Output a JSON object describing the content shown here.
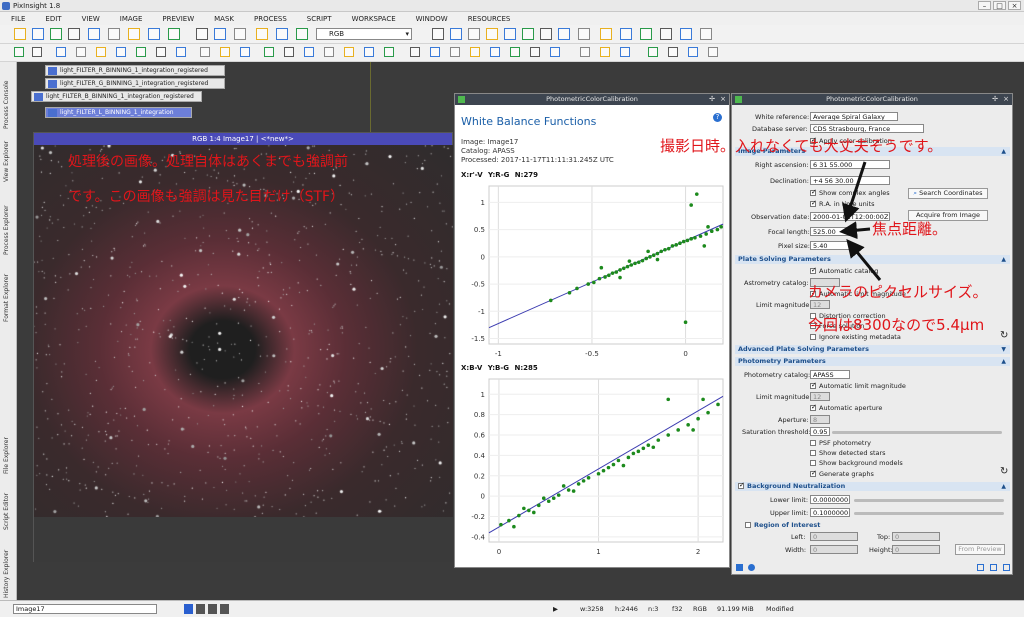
{
  "app_title": "PixInsight 1.8",
  "menu": [
    "FILE",
    "EDIT",
    "VIEW",
    "IMAGE",
    "PREVIEW",
    "MASK",
    "PROCESS",
    "SCRIPT",
    "WORKSPACE",
    "WINDOW",
    "RESOURCES"
  ],
  "toolbar": {
    "rgb_select": "RGB"
  },
  "side_tabs": [
    "Process Console",
    "View Explorer",
    "Process Explorer",
    "Format Explorer",
    "File Explorer",
    "Script Editor",
    "History Explorer"
  ],
  "icon_windows": [
    "light_FILTER_R_BINNING_1_integration_registered",
    "light_FILTER_G_BINNING_1_integration_registered",
    "light_FILTER_B_BINNING_1_integration_registered",
    "light_FILTER_L_BINNING_1_integration"
  ],
  "image_window": {
    "title": "RGB 1:4 Image17 | <*new*>"
  },
  "annotations": {
    "note1_line1": "処理後の画像。処理自体はあくまでも強調前",
    "note1_line2": "です。この画像も強調は見た目だけ（STF）",
    "note2": "撮影日時。入れなくても大丈夫そうです。",
    "note3": "焦点距離。",
    "note4_line1": "カメラのピクセルサイズ。",
    "note4_line2": "今回は8300なので5.4μm"
  },
  "wb_panel": {
    "window_title": "PhotometricColorCalibration",
    "heading": "White Balance Functions",
    "image": "Image: Image17",
    "catalog": "Catalog: APASS",
    "processed": "Processed: 2017-11-17T11:11:31.245Z UTC"
  },
  "chart_data": [
    {
      "type": "scatter",
      "title": "X:r'-V  Y:R-G  N:279",
      "xlim": [
        -1.05,
        0.2
      ],
      "ylim": [
        -1.6,
        1.3
      ],
      "xticks": [
        -1,
        -0.5,
        0
      ],
      "yticks": [
        -1.5,
        -1,
        -0.5,
        0,
        0.5,
        1
      ],
      "fit": {
        "x": [
          -1.05,
          0.2
        ],
        "y": [
          -1.3,
          0.6
        ]
      },
      "points": [
        [
          -0.72,
          -0.8
        ],
        [
          -0.62,
          -0.66
        ],
        [
          -0.58,
          -0.58
        ],
        [
          -0.52,
          -0.5
        ],
        [
          -0.49,
          -0.47
        ],
        [
          -0.46,
          -0.4
        ],
        [
          -0.43,
          -0.37
        ],
        [
          -0.41,
          -0.34
        ],
        [
          -0.39,
          -0.3
        ],
        [
          -0.37,
          -0.28
        ],
        [
          -0.35,
          -0.24
        ],
        [
          -0.33,
          -0.21
        ],
        [
          -0.31,
          -0.18
        ],
        [
          -0.29,
          -0.15
        ],
        [
          -0.27,
          -0.12
        ],
        [
          -0.25,
          -0.1
        ],
        [
          -0.23,
          -0.07
        ],
        [
          -0.21,
          -0.03
        ],
        [
          -0.19,
          0.0
        ],
        [
          -0.17,
          0.03
        ],
        [
          -0.15,
          0.06
        ],
        [
          -0.13,
          0.1
        ],
        [
          -0.11,
          0.13
        ],
        [
          -0.09,
          0.15
        ],
        [
          -0.07,
          0.2
        ],
        [
          -0.05,
          0.22
        ],
        [
          -0.03,
          0.25
        ],
        [
          -0.01,
          0.28
        ],
        [
          0.01,
          0.3
        ],
        [
          0.03,
          0.33
        ],
        [
          0.05,
          0.35
        ],
        [
          0.08,
          0.38
        ],
        [
          0.11,
          0.42
        ],
        [
          0.14,
          0.47
        ],
        [
          0.17,
          0.5
        ],
        [
          0.19,
          0.55
        ],
        [
          -0.3,
          -0.08
        ],
        [
          -0.45,
          -0.2
        ],
        [
          0.03,
          0.95
        ],
        [
          0.06,
          1.15
        ],
        [
          0.0,
          -1.2
        ],
        [
          -0.2,
          0.1
        ],
        [
          0.1,
          0.2
        ],
        [
          -0.35,
          -0.38
        ],
        [
          -0.15,
          -0.05
        ],
        [
          0.12,
          0.55
        ]
      ]
    },
    {
      "type": "scatter",
      "title": "X:B-V  Y:B-G  N:285",
      "xlim": [
        -0.1,
        2.25
      ],
      "ylim": [
        -0.45,
        1.15
      ],
      "xticks": [
        0,
        1,
        2
      ],
      "yticks": [
        -0.4,
        -0.2,
        0,
        0.2,
        0.4,
        0.6,
        0.8,
        1
      ],
      "fit": {
        "x": [
          -0.1,
          2.25
        ],
        "y": [
          -0.36,
          0.98
        ]
      },
      "points": [
        [
          0.02,
          -0.28
        ],
        [
          0.1,
          -0.24
        ],
        [
          0.2,
          -0.19
        ],
        [
          0.3,
          -0.14
        ],
        [
          0.4,
          -0.09
        ],
        [
          0.5,
          -0.05
        ],
        [
          0.55,
          -0.02
        ],
        [
          0.6,
          0.01
        ],
        [
          0.7,
          0.06
        ],
        [
          0.8,
          0.12
        ],
        [
          0.9,
          0.18
        ],
        [
          1.0,
          0.22
        ],
        [
          1.05,
          0.25
        ],
        [
          1.1,
          0.28
        ],
        [
          1.15,
          0.31
        ],
        [
          1.2,
          0.35
        ],
        [
          1.3,
          0.38
        ],
        [
          1.4,
          0.44
        ],
        [
          1.5,
          0.5
        ],
        [
          1.6,
          0.55
        ],
        [
          1.7,
          0.6
        ],
        [
          1.8,
          0.65
        ],
        [
          1.9,
          0.7
        ],
        [
          2.0,
          0.76
        ],
        [
          2.1,
          0.82
        ],
        [
          2.2,
          0.9
        ],
        [
          0.35,
          -0.16
        ],
        [
          0.45,
          -0.02
        ],
        [
          0.75,
          0.05
        ],
        [
          1.25,
          0.3
        ],
        [
          1.55,
          0.48
        ],
        [
          1.95,
          0.65
        ],
        [
          2.05,
          0.95
        ],
        [
          0.15,
          -0.3
        ],
        [
          0.65,
          0.1
        ],
        [
          1.35,
          0.42
        ],
        [
          0.85,
          0.15
        ],
        [
          1.7,
          0.95
        ],
        [
          0.25,
          -0.12
        ],
        [
          1.45,
          0.47
        ]
      ]
    }
  ],
  "pcc_panel": {
    "window_title": "PhotometricColorCalibration",
    "white_reference_label": "White reference:",
    "white_reference": "Average Spiral Galaxy",
    "db_label": "Database server:",
    "db": "CDS Strasbourg, France",
    "apply_color": "Apply color calibration",
    "image_params": "Image Parameters",
    "ra_label": "Right ascension:",
    "ra": "6 31 55.000",
    "dec_label": "Declination:",
    "dec": "+4 56 30.00",
    "complex_angles": "Show complex angles",
    "ra_units": "R.A. in time units",
    "search_coords": "Search Coordinates",
    "obs_date_label": "Observation date:",
    "obs_date": "2000-01-01T12:00:00Z",
    "acquire": "Acquire from Image",
    "focal_label": "Focal length:",
    "focal": "525.00",
    "pixel_label": "Pixel size:",
    "pixel": "5.40",
    "plate_solving": "Plate Solving Parameters",
    "auto_catalog": "Automatic catalog",
    "astro_cat_label": "Astrometry catalog:",
    "astro_cat": "",
    "auto_limit": "Automatic limit magnitude",
    "limit_mag_label": "Limit magnitude:",
    "limit_mag": "12",
    "distortion": "Distortion correction",
    "force_solution": "Force solution",
    "ignore_meta": "Ignore existing metadata",
    "adv_plate": "Advanced Plate Solving Parameters",
    "photometry": "Photometry Parameters",
    "phot_cat_label": "Photometry catalog:",
    "phot_cat": "APASS",
    "phot_auto_limit": "Automatic limit magnitude",
    "phot_limit_label": "Limit magnitude:",
    "phot_limit": "12",
    "auto_aperture": "Automatic aperture",
    "aperture_label": "Aperture:",
    "aperture": "8",
    "saturation_label": "Saturation threshold:",
    "saturation": "0.95",
    "psf": "PSF photometry",
    "show_detected": "Show detected stars",
    "show_bg": "Show background models",
    "gen_graphs": "Generate graphs",
    "bg_neutral": "Background Neutralization",
    "lower_label": "Lower limit:",
    "lower": "0.0000000",
    "upper_label": "Upper limit:",
    "upper": "0.1000000",
    "roi": "Region of Interest",
    "left_label": "Left:",
    "left": "0",
    "top_label": "Top:",
    "top": "0",
    "width_label": "Width:",
    "width": "0",
    "height_label": "Height:",
    "height": "0",
    "from_preview": "From Preview"
  },
  "status": {
    "view": "Image17",
    "w": "w:3258",
    "h": "h:2446",
    "n": "n:3",
    "bits": "f32",
    "mode": "RGB",
    "mem": "91.199 MiB",
    "state": "Modified"
  }
}
